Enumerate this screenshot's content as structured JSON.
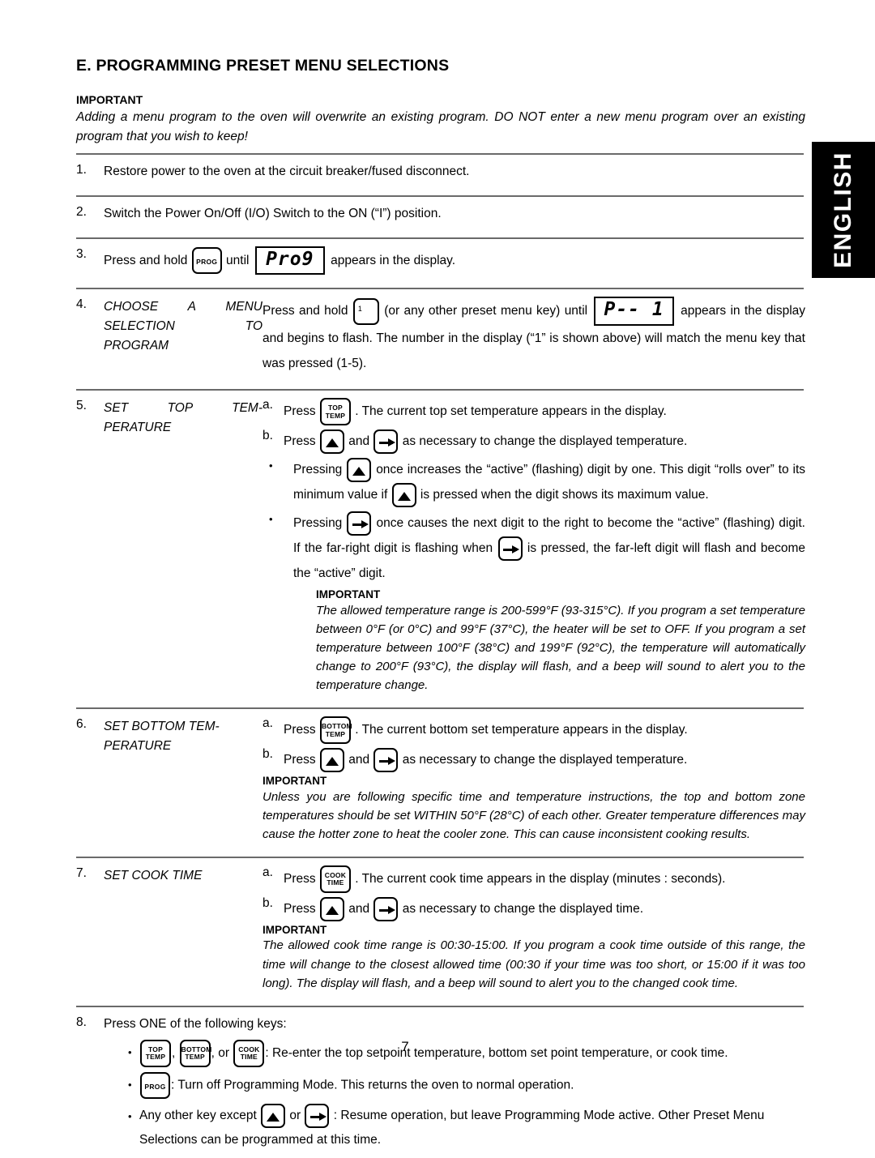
{
  "language_tab": {
    "label": "ENGLISH"
  },
  "section": {
    "title": "E.  PROGRAMMING PRESET MENU SELECTIONS"
  },
  "intro_important": {
    "heading": "IMPORTANT",
    "body": "Adding a menu program to the oven will overwrite an existing program.  DO NOT enter a new menu program over an existing program that you wish to keep!"
  },
  "keys": {
    "prog": "PROG",
    "top_temp_line1": "TOP",
    "top_temp_line2": "TEMP",
    "bottom_temp_line1": "BOTTOM",
    "bottom_temp_line2": "TEMP",
    "cook_time_line1": "COOK",
    "cook_time_line2": "TIME",
    "menu_one": "1",
    "up_arrow": "up-arrow",
    "right_arrow": "right-arrow"
  },
  "displays": {
    "prog": "Pro9",
    "preset": "P--  1"
  },
  "steps": {
    "s1": {
      "num": "1.",
      "text": "Restore power to the oven at the circuit breaker/fused disconnect."
    },
    "s2": {
      "num": "2.",
      "text": "Switch the Power On/Off (I/O) Switch to the ON (“I”) position."
    },
    "s3": {
      "num": "3.",
      "t1": "Press and hold",
      "t2": "until",
      "t3": "appears in the display."
    },
    "s4": {
      "num": "4.",
      "label_l1": "CHOOSE A MENU",
      "label_l2": "SELECTION TO",
      "label_l3": "PROGRAM",
      "t1": "Press and hold",
      "t2": "(or any other preset menu key) until",
      "t3": "appears in the display and begins to flash.  The number in the display (“1” is shown above) will match the menu key that was pressed (1-5)."
    },
    "s5": {
      "num": "5.",
      "label_l1": "SET TOP TEM-",
      "label_l2": "PERATURE",
      "a_mark": "a.",
      "a_t1": "Press",
      "a_t2": ".  The current top set temperature appears in the display.",
      "b_mark": "b.",
      "b_t1": "Press",
      "b_t2": "and",
      "b_t3": "as necessary to change the displayed temperature.",
      "bullet1_t1": "Pressing",
      "bullet1_t2": "once increases the “active” (flashing) digit by one.  This digit “rolls over” to its minimum value if",
      "bullet1_t3": "is pressed when the digit shows its maximum value.",
      "bullet2_t1": "Pressing",
      "bullet2_t2": "once causes the next digit to the right to become the “active” (flashing) digit.  If the far-right digit is flashing when",
      "bullet2_t3": "is pressed, the far-left digit will flash and become the “active” digit.",
      "note_head": "IMPORTANT",
      "note_body": "The allowed temperature range is 200-599°F (93-315°C).  If you program a set temperature between 0°F (or 0°C) and 99°F (37°C), the heater will be set to OFF.  If you program a set temperature between 100°F (38°C) and 199°F (92°C), the temperature will automatically change to 200°F (93°C), the display will flash, and a beep will sound to alert you to the temperature change."
    },
    "s6": {
      "num": "6.",
      "label_l1": "SET BOTTOM TEM-",
      "label_l2": "PERATURE",
      "a_mark": "a.",
      "a_t1": "Press",
      "a_t2": ".  The current bottom set temperature appears in the display.",
      "b_mark": "b.",
      "b_t1": "Press",
      "b_t2": "and",
      "b_t3": "as necessary to change the displayed temperature.",
      "note_head": "IMPORTANT",
      "note_body": "Unless you are following specific time and temperature instructions, the top and bottom zone temperatures should be set WITHIN 50°F (28°C) of each other.  Greater temperature differences may cause the hotter zone to heat the cooler zone.  This can cause inconsistent cooking results."
    },
    "s7": {
      "num": "7.",
      "label_l1": "SET COOK TIME",
      "a_mark": "a.",
      "a_t1": "Press",
      "a_t2": ".  The current cook time appears in the display (minutes : seconds).",
      "b_mark": "b.",
      "b_t1": "Press",
      "b_t2": "and",
      "b_t3": "as necessary to change the displayed time.",
      "note_head": "IMPORTANT",
      "note_body": "The allowed cook time range is 00:30-15:00.  If you program a cook time outside of this range, the time will change to the closest allowed time (00:30 if your time was too short, or 15:00 if it was too long).  The display will flash, and a beep will sound to alert you to the changed cook time."
    },
    "s8": {
      "num": "8.",
      "text": "Press ONE of the following keys:",
      "b1_sep1": ",",
      "b1_sep2": ", or",
      "b1_text": ":  Re-enter the top setpoint temperature, bottom set point temperature, or cook time.",
      "b2_text": ":  Turn off Programming Mode.  This returns the oven to normal operation.",
      "b3_t1": "Any other key except",
      "b3_t2": "or",
      "b3_t3": ":  Resume operation, but leave Programming Mode active.  Other Preset Menu Selections can be programmed at this time."
    }
  },
  "bullet_glyph": "•",
  "page_number": "7"
}
